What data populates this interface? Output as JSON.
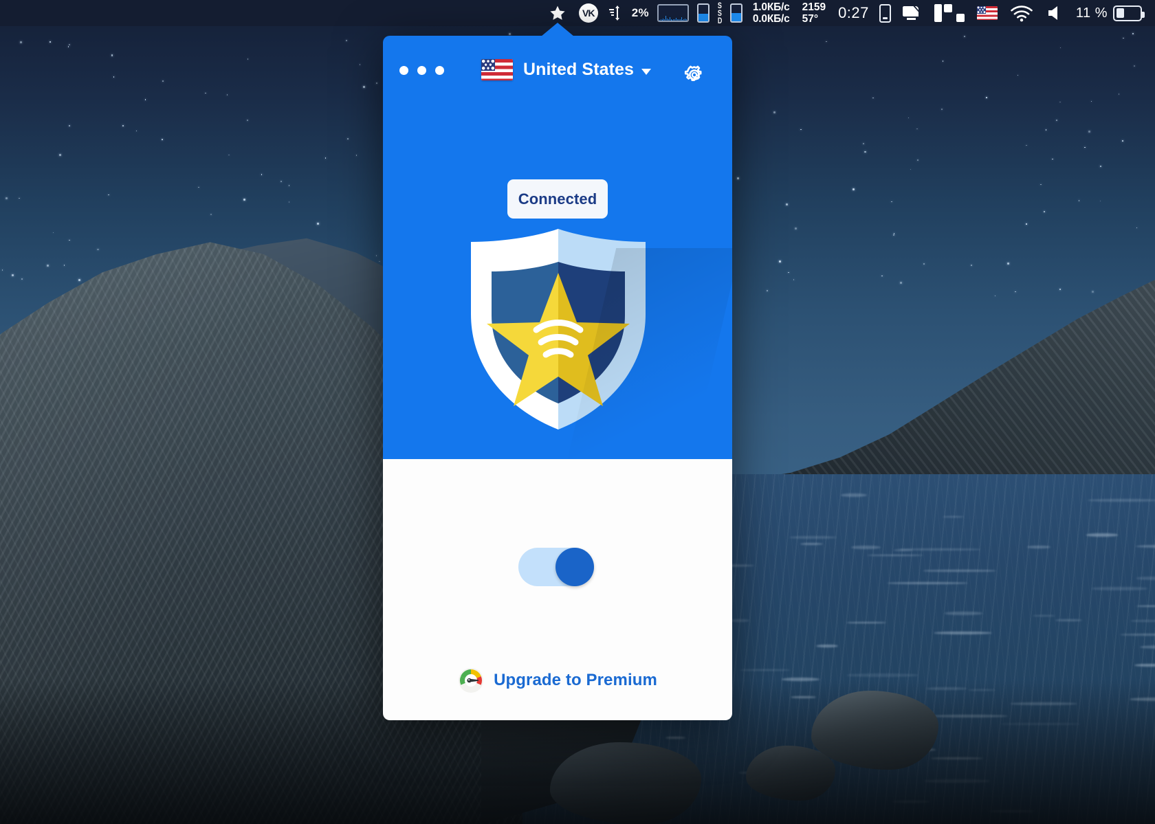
{
  "menubar": {
    "icons": {
      "star": "star-icon",
      "vk": "vk-icon",
      "network_arrows": "network-activity-icon",
      "display": "display-icon",
      "split_view": "split-view-icon",
      "flag": "us-flag-icon",
      "wifi": "wifi-icon",
      "volume": "volume-icon",
      "battery_small": "battery-small-icon",
      "battery_large": "battery-icon"
    },
    "cpu_percent": "2%",
    "vk_label": "VK",
    "ssd_label_chars": [
      "S",
      "S",
      "D"
    ],
    "net_down": "1.0КБ/c",
    "net_up": "0.0КБ/c",
    "fan_rpm": "2159",
    "cpu_temp": "57°",
    "clock": "0:27",
    "battery_percent": "11 %"
  },
  "popover": {
    "header": {
      "menu_dots": "more-options",
      "flag": "us-flag-icon",
      "country": "United States",
      "caret": "chevron-down-icon",
      "settings": "gear-icon"
    },
    "status": {
      "label": "Connected"
    },
    "logo": {
      "name": "vpn-shield-logo",
      "shield_left_color": "#ffffff",
      "shield_right_color": "#bcdcf7",
      "inner_left_color": "#2c6199",
      "inner_right_color": "#1e3f7a",
      "star_left_color": "#f5d83a",
      "star_right_color": "#e0bd1e"
    },
    "toggle": {
      "name": "vpn-power-toggle",
      "state": "on",
      "track_color": "#c3e0fb",
      "knob_color": "#1a64c8"
    },
    "upgrade": {
      "icon": "speedometer-icon",
      "label": "Upgrade to Premium",
      "color": "#1a6ad2"
    },
    "accent_color": "#1477ed",
    "panel_bg": "#fdfdfd"
  }
}
